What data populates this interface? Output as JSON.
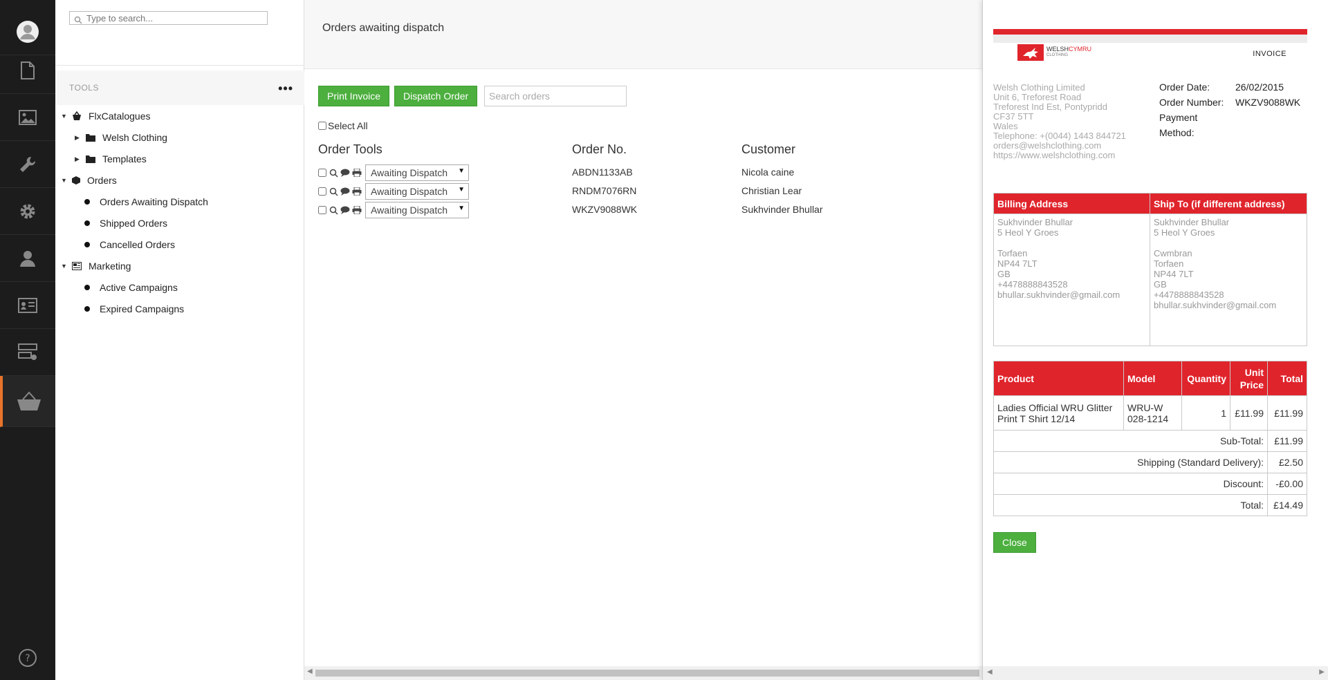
{
  "tools": {
    "search_placeholder": "Type to search...",
    "heading": "TOOLS",
    "more": "•••",
    "tree": {
      "flx": "FlxCatalogues",
      "welsh": "Welsh Clothing",
      "templates": "Templates",
      "orders": "Orders",
      "awaiting": "Orders Awaiting Dispatch",
      "shipped": "Shipped Orders",
      "cancelled": "Cancelled Orders",
      "marketing": "Marketing",
      "active": "Active Campaigns",
      "expired": "Expired Campaigns"
    }
  },
  "main": {
    "title": "Orders awaiting dispatch",
    "print_invoice": "Print Invoice",
    "dispatch_order": "Dispatch Order",
    "search_placeholder": "Search orders",
    "select_all": "Select All",
    "columns": {
      "tools": "Order Tools",
      "order_no": "Order No.",
      "customer": "Customer"
    },
    "orders": [
      {
        "status": "Awaiting Dispatch",
        "order_no": "ABDN1133AB",
        "customer": "Nicola caine"
      },
      {
        "status": "Awaiting Dispatch",
        "order_no": "RNDM7076RN",
        "customer": "Christian Lear"
      },
      {
        "status": "Awaiting Dispatch",
        "order_no": "WKZV9088WK",
        "customer": "Sukhvinder Bhullar"
      }
    ]
  },
  "invoice": {
    "logo_welsh": "WELSH",
    "logo_cymru": "CYMRU",
    "logo_sub": "CLOTHING",
    "title": "INVOICE",
    "company_lines": [
      "Welsh Clothing Limited",
      "Unit 6, Treforest Road",
      "Treforest Ind Est, Pontypridd",
      "CF37 5TT",
      "Wales",
      "Telephone: +(0044) 1443 844721",
      "orders@welshclothing.com",
      "https://www.welshclothing.com"
    ],
    "order_date_label": "Order Date:",
    "order_date": "26/02/2015",
    "order_number_label": "Order Number:",
    "order_number": "WKZV9088WK",
    "payment_label": "Payment",
    "method_label": "Method:",
    "billing_header": "Billing Address",
    "shipto_header": "Ship To (if different address)",
    "billing_lines": [
      "Sukhvinder Bhullar",
      "5 Heol Y Groes",
      "",
      "Torfaen",
      "NP44 7LT",
      "GB",
      "+4478888843528",
      "bhullar.sukhvinder@gmail.com"
    ],
    "shipto_lines": [
      "Sukhvinder Bhullar",
      "5 Heol Y Groes",
      "",
      "Cwmbran",
      "Torfaen",
      "NP44 7LT",
      "GB",
      "+4478888843528",
      "bhullar.sukhvinder@gmail.com"
    ],
    "items_headers": {
      "product": "Product",
      "model": "Model",
      "quantity": "Quantity",
      "unit": "Unit",
      "price": "Price",
      "total": "Total"
    },
    "items": [
      {
        "product": "Ladies Official WRU Glitter Print T Shirt 12/14",
        "model": "WRU-W 028-1214",
        "quantity": "1",
        "unit_price": "£11.99",
        "total": "£11.99"
      }
    ],
    "subtotal_label": "Sub-Total:",
    "subtotal": "£11.99",
    "shipping_label": "Shipping (Standard Delivery):",
    "shipping": "£2.50",
    "discount_label": "Discount:",
    "discount": "-£0.00",
    "total_label": "Total:",
    "total": "£14.49",
    "close": "Close"
  },
  "colors": {
    "accent_green": "#4caf3e",
    "brand_red": "#e0242c",
    "rail_active": "#e8742a"
  },
  "icons": [
    "avatar-icon",
    "document-icon",
    "image-icon",
    "wrench-icon",
    "gear-icon",
    "user-icon",
    "id-card-icon",
    "server-icon",
    "basket-icon",
    "help-icon"
  ]
}
